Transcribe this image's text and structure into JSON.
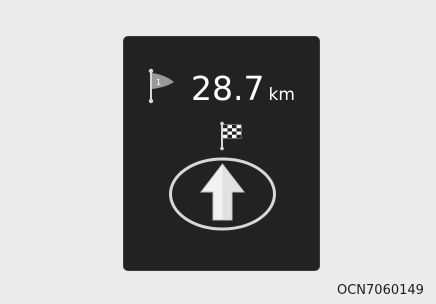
{
  "display": {
    "waypoint_number": "1",
    "distance_value": "28.7",
    "distance_unit": "km",
    "icons": {
      "waypoint": "waypoint-flag-icon",
      "destination": "checkered-flag-icon",
      "direction": "straight-arrow-icon"
    },
    "colors": {
      "panel": "#222222",
      "icon": "#d8d8d8",
      "text": "#ffffff"
    }
  },
  "figure_code": "OCN7060149"
}
